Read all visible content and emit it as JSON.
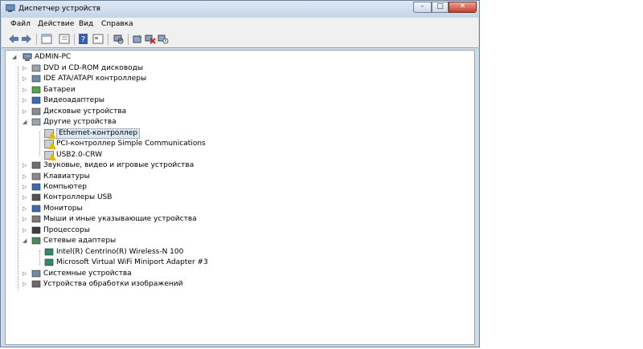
{
  "window": {
    "title": "Диспетчер устройств",
    "controls": {
      "minimize": "–",
      "maximize": "□",
      "close": "✕"
    }
  },
  "menu": [
    "Файл",
    "Действие",
    "Вид",
    "Справка"
  ],
  "toolbar": [
    {
      "icon": "back-arrow-icon"
    },
    {
      "icon": "forward-arrow-icon"
    },
    {
      "icon": "properties-window-icon"
    },
    {
      "icon": "show-hide-tree-icon"
    },
    {
      "icon": "help-icon"
    },
    {
      "icon": "view-icon"
    },
    {
      "icon": "scan-hardware-icon"
    },
    {
      "icon": "update-driver-icon"
    },
    {
      "icon": "uninstall-icon"
    },
    {
      "icon": "disable-device-icon"
    }
  ],
  "tree": {
    "root": {
      "label": "ADMIN-PC",
      "icon": "computer-icon"
    },
    "nodes": [
      {
        "label": "DVD и CD-ROM дисководы",
        "icon": "dvd-drive-icon",
        "level": 1,
        "expander": "▷"
      },
      {
        "label": "IDE ATA/ATAPI контроллеры",
        "icon": "ide-controller-icon",
        "level": 1,
        "expander": "▷"
      },
      {
        "label": "Батареи",
        "icon": "battery-icon",
        "level": 1,
        "expander": "▷"
      },
      {
        "label": "Видеоадаптеры",
        "icon": "display-adapter-icon",
        "level": 1,
        "expander": "▷"
      },
      {
        "label": "Дисковые устройства",
        "icon": "disk-drive-icon",
        "level": 1,
        "expander": "▷"
      },
      {
        "label": "Другие устройства",
        "icon": "other-devices-icon",
        "level": 1,
        "expander": "◢"
      },
      {
        "label": "Ethernet-контроллер",
        "icon": "warning-device-icon",
        "level": 2,
        "selected": true
      },
      {
        "label": "PCI-контроллер Simple Communications",
        "icon": "warning-device-icon",
        "level": 2
      },
      {
        "label": "USB2.0-CRW",
        "icon": "warning-device-icon",
        "level": 2
      },
      {
        "label": "Звуковые, видео и игровые устройства",
        "icon": "sound-icon",
        "level": 1,
        "expander": "▷"
      },
      {
        "label": "Клавиатуры",
        "icon": "keyboard-icon",
        "level": 1,
        "expander": "▷"
      },
      {
        "label": "Компьютер",
        "icon": "monitor-computer-icon",
        "level": 1,
        "expander": "▷"
      },
      {
        "label": "Контроллеры USB",
        "icon": "usb-icon",
        "level": 1,
        "expander": "▷"
      },
      {
        "label": "Мониторы",
        "icon": "monitor-icon",
        "level": 1,
        "expander": "▷"
      },
      {
        "label": "Мыши и иные указывающие устройства",
        "icon": "mouse-icon",
        "level": 1,
        "expander": "▷"
      },
      {
        "label": "Процессоры",
        "icon": "processor-icon",
        "level": 1,
        "expander": "▷"
      },
      {
        "label": "Сетевые адаптеры",
        "icon": "network-adapter-icon",
        "level": 1,
        "expander": "◢"
      },
      {
        "label": "Intel(R) Centrino(R) Wireless-N 100",
        "icon": "network-card-icon",
        "level": 2
      },
      {
        "label": "Microsoft Virtual WiFi Miniport Adapter #3",
        "icon": "network-card-icon",
        "level": 2
      },
      {
        "label": "Системные устройства",
        "icon": "system-devices-icon",
        "level": 1,
        "expander": "▷"
      },
      {
        "label": "Устройства обработки изображений",
        "icon": "imaging-device-icon",
        "level": 1,
        "expander": "▷"
      }
    ]
  },
  "colors": {
    "selection": "#dde8f6",
    "warning": "#e8b800"
  }
}
